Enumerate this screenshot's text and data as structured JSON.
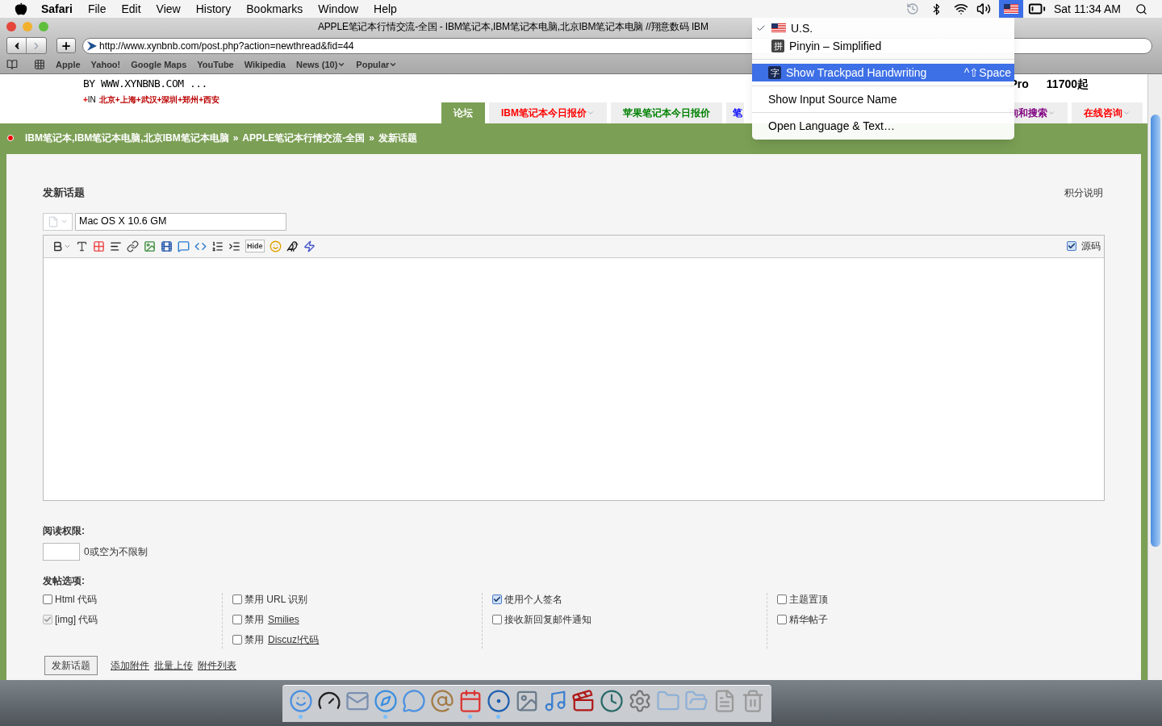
{
  "menubar": {
    "app": "Safari",
    "menus": [
      "File",
      "Edit",
      "View",
      "History",
      "Bookmarks",
      "Window",
      "Help"
    ],
    "clock": "Sat 11:34 AM"
  },
  "window": {
    "title": "APPLE笔记本行情交流-全国 - IBM笔记本,IBM笔记本电脑,北京IBM笔记本电脑 //翔意数码 IBM",
    "url": "http://www.xynbnb.com/post.php?action=newthread&fid=44",
    "bookmarks": [
      {
        "label": "Apple",
        "has_menu": false
      },
      {
        "label": "Yahoo!",
        "has_menu": false
      },
      {
        "label": "Google Maps",
        "has_menu": false
      },
      {
        "label": "YouTube",
        "has_menu": false
      },
      {
        "label": "Wikipedia",
        "has_menu": false
      },
      {
        "label": "News (10)",
        "has_menu": true
      },
      {
        "label": "Popular",
        "has_menu": true
      }
    ]
  },
  "input_menu": {
    "items": [
      {
        "kind": "source",
        "label": "U.S.",
        "checked": true
      },
      {
        "kind": "source",
        "glyph": "拼",
        "label": "Pinyin – Simplified",
        "checked": false
      },
      {
        "kind": "separator"
      },
      {
        "kind": "command",
        "glyph": "字",
        "label": "Show Trackpad Handwriting",
        "shortcut": "^⇧Space",
        "highlighted": true
      },
      {
        "kind": "separator"
      },
      {
        "kind": "command",
        "label": "Show Input Source Name",
        "highlighted": false
      },
      {
        "kind": "separator"
      },
      {
        "kind": "command",
        "label": "Open Language & Text…",
        "highlighted": false
      }
    ]
  },
  "header": {
    "tagline": "BY WWW.XYNBNB.COM ...",
    "plus": "+",
    "region_prefix": "IN",
    "cities": "北京+上海+武汉+深圳+郑州+西安",
    "promo_model": "Pro",
    "promo_price": "11700起"
  },
  "nav_tabs": [
    {
      "label": "论坛",
      "selected": true,
      "has_menu": false,
      "cut_off": false
    },
    {
      "label": "IBM笔记本今日报价",
      "selected": false,
      "color": "#ff0000",
      "has_menu": true,
      "cut_off": false
    },
    {
      "label": "苹果笔记本今日报价",
      "selected": false,
      "color": "#008000",
      "has_menu": false,
      "cut_off": false
    },
    {
      "label": "笔",
      "selected": false,
      "color": "#0000ff",
      "has_menu": false,
      "cut_off": true
    },
    {
      "label": "询和搜索",
      "selected": false,
      "color": "#800080",
      "has_menu": true,
      "cut_off": false
    },
    {
      "label": "在线咨询",
      "selected": false,
      "color": "#ff0000",
      "has_menu": true,
      "cut_off": false
    }
  ],
  "breadcrumb": [
    {
      "label": "IBM笔记本,IBM笔记本电脑,北京IBM笔记本电脑",
      "separator": "»"
    },
    {
      "label": "APPLE笔记本行情交流-全国",
      "separator": "»"
    },
    {
      "label": "发新话题"
    }
  ],
  "form": {
    "title": "发新话题",
    "help_link": "积分说明",
    "subject": {
      "value": "Mac OS X 10.6 GM"
    },
    "editor": {
      "toolbar": [
        {
          "kind": "bold"
        },
        {
          "kind": "size"
        },
        {
          "kind": "color"
        },
        {
          "kind": "align"
        },
        {
          "kind": "link"
        },
        {
          "kind": "image"
        },
        {
          "kind": "media"
        },
        {
          "kind": "quote"
        },
        {
          "kind": "code"
        },
        {
          "kind": "list"
        },
        {
          "kind": "indent"
        },
        {
          "kind": "hide",
          "label": "Hide"
        },
        {
          "kind": "smiley"
        },
        {
          "kind": "penguin"
        },
        {
          "kind": "flash"
        }
      ],
      "source_toggle": {
        "label": "源码",
        "checked": true
      }
    },
    "read_permission": {
      "label": "阅读权限:",
      "hint": "0或空为不限制"
    },
    "options_label": "发帖选项:",
    "option_columns": [
      [
        {
          "label": "Html 代码",
          "checked": false,
          "disabled": false
        },
        {
          "label": "[img] 代码",
          "checked": true,
          "disabled": true
        }
      ],
      [
        {
          "label": "禁用 URL 识别",
          "checked": false,
          "disabled": false
        },
        {
          "label": "禁用",
          "link": "Smilies",
          "checked": false,
          "disabled": false
        },
        {
          "label": "禁用",
          "link": "Discuz!代码",
          "checked": false,
          "disabled": false
        }
      ],
      [
        {
          "label": "使用个人签名",
          "checked": true,
          "disabled": false
        },
        {
          "label": "接收新回复邮件通知",
          "checked": false,
          "disabled": false
        }
      ],
      [
        {
          "label": "主题置顶",
          "checked": false,
          "disabled": false
        },
        {
          "label": "精华帖子",
          "checked": false,
          "disabled": false
        }
      ]
    ],
    "submit": "发新话题",
    "links": [
      "添加附件",
      "批量上传",
      "附件列表"
    ]
  },
  "dock": [
    {
      "kind": "finder",
      "running": true
    },
    {
      "kind": "dashboard",
      "running": false
    },
    {
      "kind": "mail",
      "running": false
    },
    {
      "kind": "safari",
      "running": true
    },
    {
      "kind": "ichat",
      "running": false
    },
    {
      "kind": "contacts",
      "running": false
    },
    {
      "kind": "calendar",
      "running": true
    },
    {
      "kind": "quicktime",
      "running": true
    },
    {
      "kind": "photos",
      "running": false
    },
    {
      "kind": "music",
      "running": false
    },
    {
      "kind": "movies",
      "running": false
    },
    {
      "kind": "timemachine",
      "running": false
    },
    {
      "kind": "settings",
      "running": false
    },
    {
      "kind": "folder",
      "running": false
    },
    {
      "kind": "docs-folder",
      "running": false
    },
    {
      "kind": "document",
      "running": false
    },
    {
      "kind": "trash",
      "running": false
    }
  ]
}
